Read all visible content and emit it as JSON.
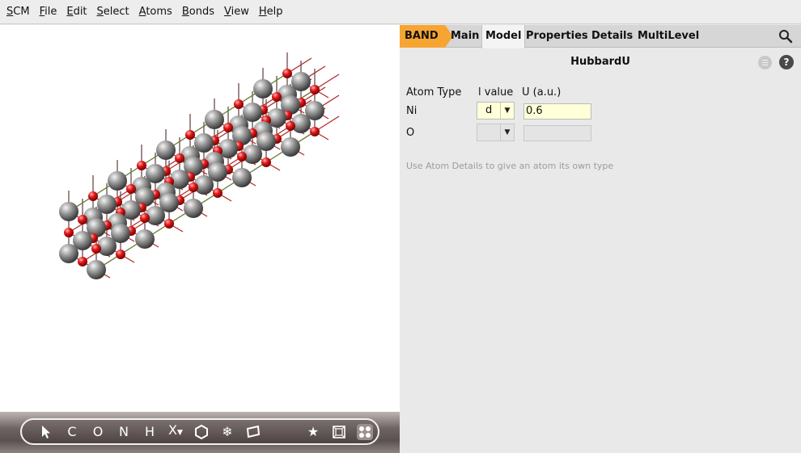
{
  "menubar": {
    "items": [
      "SCM",
      "File",
      "Edit",
      "Select",
      "Atoms",
      "Bonds",
      "View",
      "Help"
    ]
  },
  "toolbar": {
    "tools": [
      "pointer-icon",
      "C",
      "O",
      "N",
      "H",
      "X",
      "hexagon-icon",
      "snowflake-icon",
      "slab-icon",
      "star-icon",
      "cell-icon",
      "grid-icon"
    ],
    "c_label": "C",
    "o_label": "O",
    "n_label": "N",
    "h_label": "H",
    "x_label": "X"
  },
  "tabs": {
    "band": "BAND",
    "main": "Main",
    "model": "Model",
    "properties": "Properties",
    "details": "Details",
    "multilevel": "MultiLevel",
    "active": "Model"
  },
  "panel": {
    "title": "HubbardU",
    "headers": {
      "atom_type": "Atom Type",
      "l_value": "l value",
      "u_value": "U (a.u.)"
    },
    "rows": [
      {
        "atom": "Ni",
        "l_value": "d",
        "u": "0.6"
      },
      {
        "atom": "O",
        "l_value": "",
        "u": ""
      }
    ],
    "hint": "Use Atom Details to give an atom its own type",
    "help_label": "?"
  },
  "colors": {
    "accent_tab": "#f6a533",
    "field_bg": "#ffffd8",
    "nickel_atom": "#8a8a8a",
    "oxygen_atom": "#e01818",
    "bond": "#8b2b2b"
  }
}
